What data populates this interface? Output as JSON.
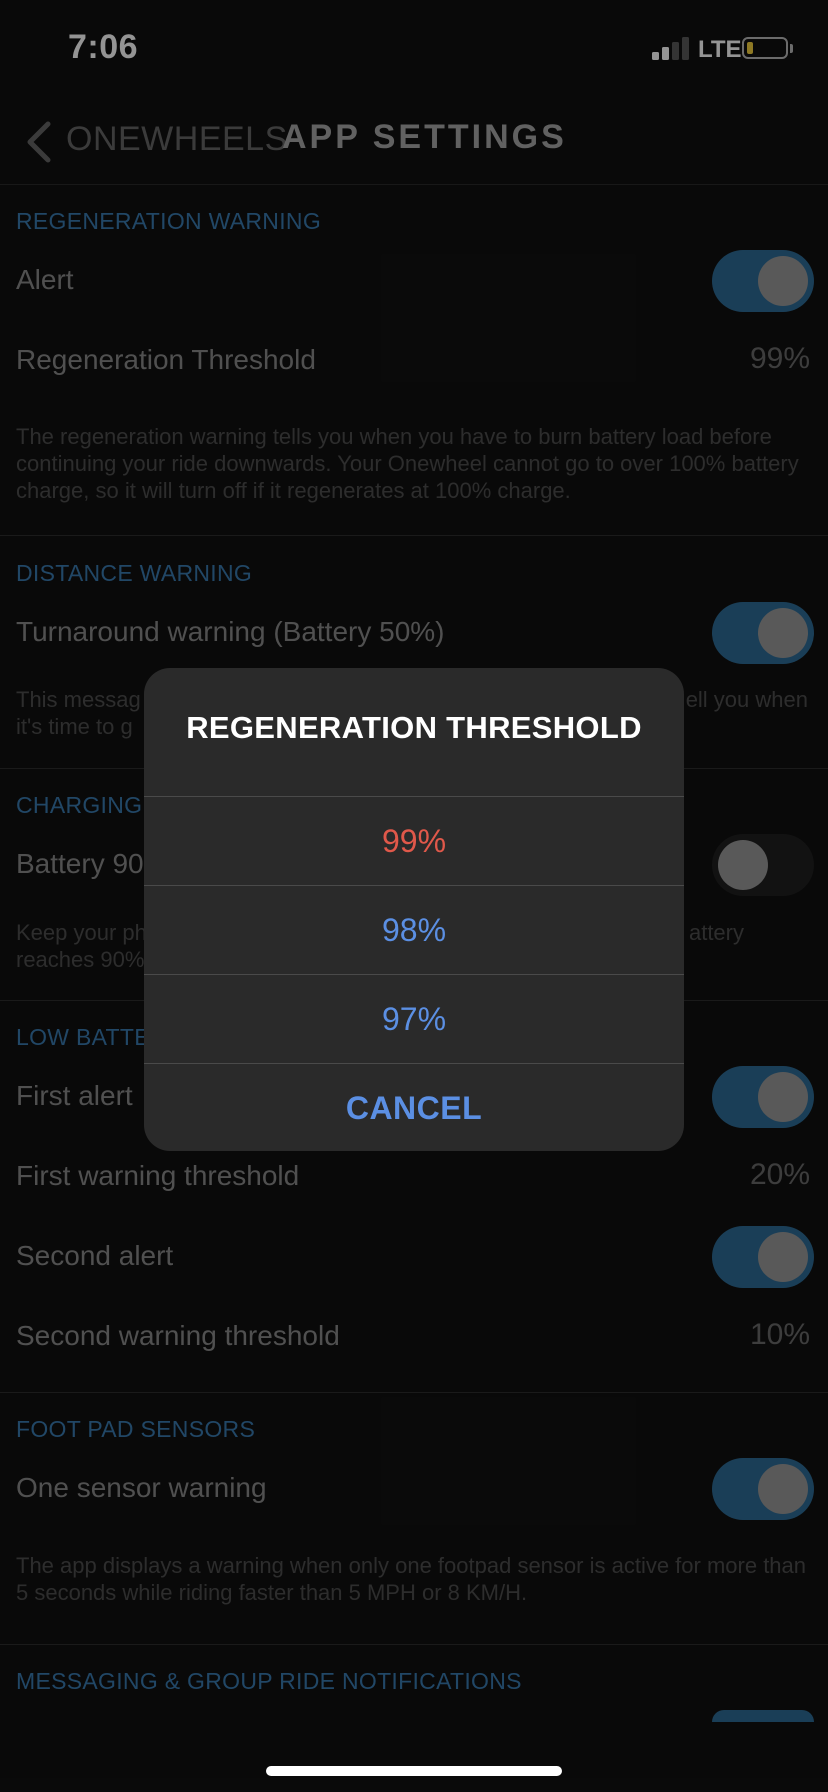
{
  "status_bar": {
    "time": "7:06",
    "network": "LTE"
  },
  "nav": {
    "back_label": "ONEWHEELS",
    "title": "APP SETTINGS"
  },
  "sections": {
    "regen": {
      "header": "REGENERATION WARNING",
      "alert_label": "Alert",
      "alert_on": true,
      "threshold_label": "Regeneration Threshold",
      "threshold_value": "99%",
      "description": "The regeneration warning tells you when you have to burn battery load before continuing your ride downwards. Your Onewheel cannot go to over 100% battery charge, so it will turn off if it regenerates at 100% charge."
    },
    "distance": {
      "header": "DISTANCE WARNING",
      "turnaround_label": "Turnaround warning (Battery 50%)",
      "turnaround_on": true,
      "description_left": "This messag",
      "description_right": "ell you when",
      "description_line2": "it's time to g"
    },
    "charging": {
      "header": "CHARGING S",
      "battery_label": "Battery 90",
      "battery_on": false,
      "description_left": "Keep your ph",
      "description_right": "attery",
      "description_line2": "reaches 90%"
    },
    "low_battery": {
      "header": "LOW BATTER",
      "first_alert_label": "First alert",
      "first_alert_on": true,
      "first_threshold_label": "First warning threshold",
      "first_threshold_value": "20%",
      "second_alert_label": "Second alert",
      "second_alert_on": true,
      "second_threshold_label": "Second warning threshold",
      "second_threshold_value": "10%"
    },
    "foot_pad": {
      "header": "FOOT PAD SENSORS",
      "one_sensor_label": "One sensor warning",
      "one_sensor_on": true,
      "description": "The app displays a warning when only one footpad sensor is active for more than 5 seconds while riding faster than 5 MPH or 8 KM/H."
    },
    "messaging": {
      "header": "MESSAGING & GROUP RIDE NOTIFICATIONS"
    }
  },
  "dialog": {
    "title": "REGENERATION THRESHOLD",
    "options": [
      "99%",
      "98%",
      "97%"
    ],
    "selected": "99%",
    "cancel": "CANCEL"
  },
  "colors": {
    "accent_blue": "#5b8fe3",
    "selected_red": "#e0584a",
    "section_header": "#3a7ab0",
    "toggle_on": "#2e6c96"
  }
}
